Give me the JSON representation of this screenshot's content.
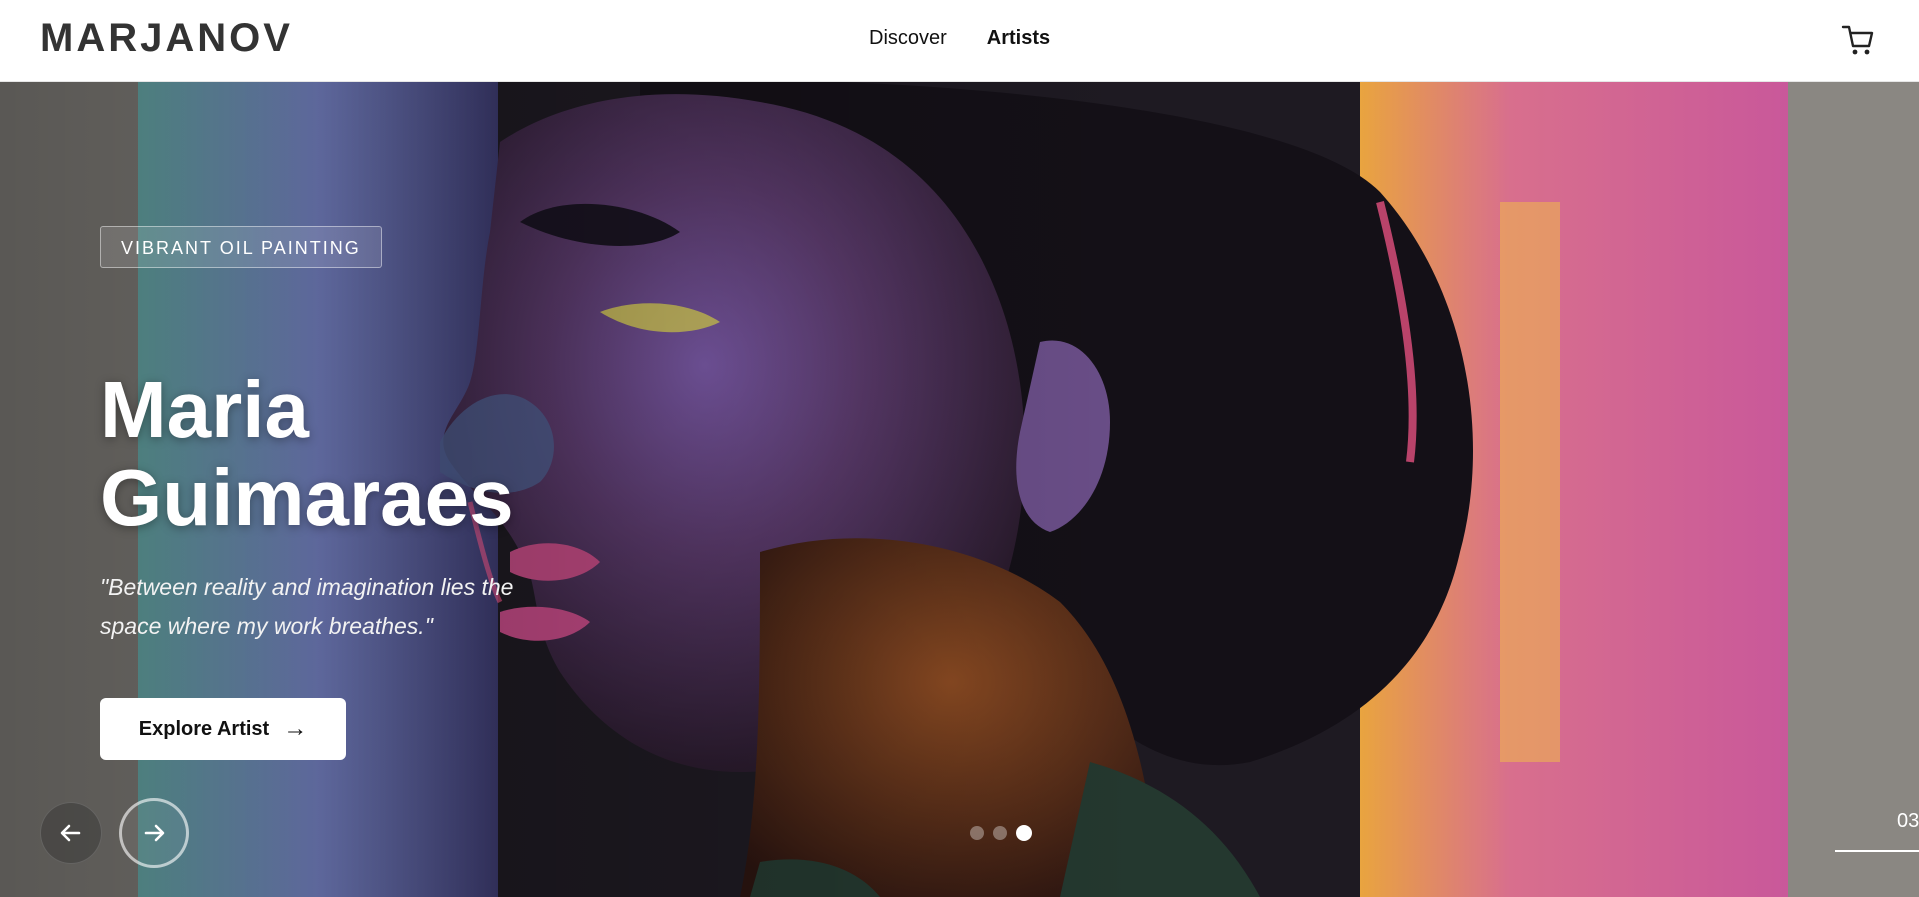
{
  "header": {
    "logo": "MARJANOV",
    "nav": [
      {
        "label": "Discover",
        "active": false
      },
      {
        "label": "Artists",
        "active": true
      }
    ],
    "cart_icon": "cart-icon"
  },
  "hero": {
    "tag": "VIBRANT OIL PAINTING",
    "artist_name_line1": "Maria",
    "artist_name_line2": "Guimaraes",
    "quote_line1": "\"Between reality and imagination lies the",
    "quote_line2": "space where my work breathes.\"",
    "cta_label": "Explore Artist",
    "cta_arrow": "→",
    "prev_icon": "arrow-left-icon",
    "next_icon": "arrow-right-icon",
    "slides_total": 3,
    "slide_active": 3,
    "counter": "03"
  },
  "colors": {
    "accent": "#ffffff",
    "logo": "#333333",
    "hero_bg": "#8a8883",
    "painting_pink": "#d2689c",
    "painting_teal": "#5fa6a4",
    "painting_orange": "#e3a74e"
  }
}
